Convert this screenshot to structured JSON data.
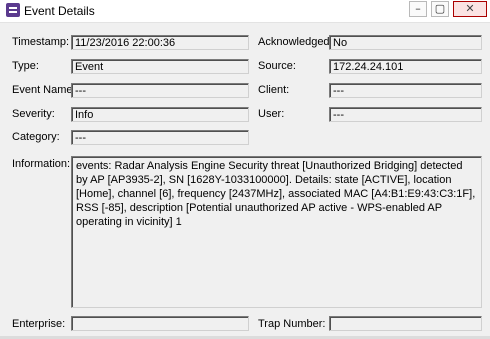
{
  "window": {
    "title": "Event Details",
    "icon": "event-app-icon",
    "controls": {
      "minimize": "–",
      "maximize": "▢",
      "close": "✕"
    }
  },
  "fields": {
    "timestamp": {
      "label": "Timestamp:",
      "value": "11/23/2016 22:00:36"
    },
    "acknowledged": {
      "label": "Acknowledged:",
      "value": "No"
    },
    "type": {
      "label": "Type:",
      "value": "Event"
    },
    "source": {
      "label": "Source:",
      "value": "172.24.24.101"
    },
    "event_name": {
      "label": "Event Name:",
      "value": "---"
    },
    "client": {
      "label": "Client:",
      "value": "---"
    },
    "severity": {
      "label": "Severity:",
      "value": "Info"
    },
    "user": {
      "label": "User:",
      "value": "---"
    },
    "category": {
      "label": "Category:",
      "value": "---"
    },
    "information": {
      "label": "Information:",
      "value": "events:  Radar Analysis Engine Security threat [Unauthorized Bridging] detected by AP [AP3935-2], SN [1628Y-1033100000]. Details: state [ACTIVE], location [Home], channel [6], frequency [2437MHz], associated MAC [A4:B1:E9:43:C3:1F], RSS [-85], description [Potential unauthorized AP active - WPS-enabled AP operating in vicinity] 1"
    },
    "enterprise": {
      "label": "Enterprise:",
      "value": ""
    },
    "trap_number": {
      "label": "Trap Number:",
      "value": ""
    }
  }
}
